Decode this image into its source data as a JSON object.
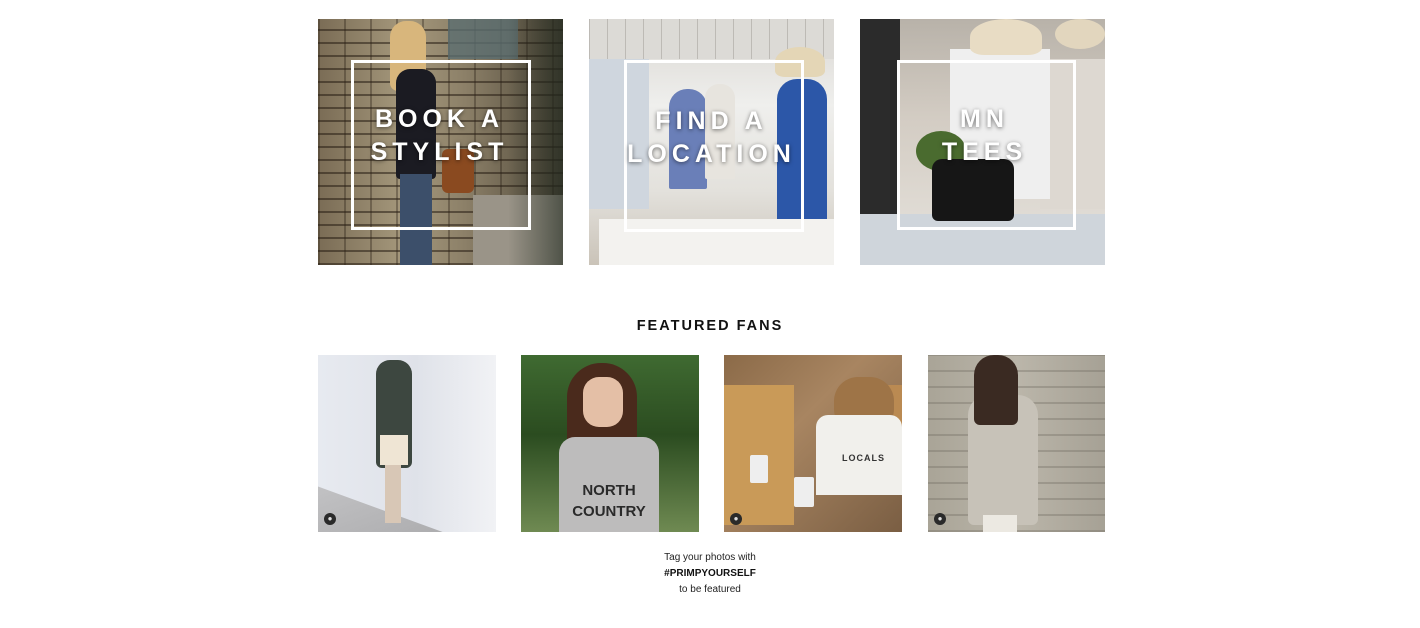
{
  "promos": [
    {
      "line1": "BOOK A",
      "line2": "STYLIST"
    },
    {
      "line1": "FIND A",
      "line2": "LOCATION"
    },
    {
      "line1": "MN",
      "line2": "TEES"
    }
  ],
  "featured": {
    "title": "FEATURED FANS",
    "fan_tees": {
      "fan2_line1": "NORTH",
      "fan2_line2": "COUNTRY",
      "fan3": "LOCALS"
    },
    "caption_line1": "Tag your photos with",
    "caption_hashtag": "#PRIMPYOURSELF",
    "caption_line3": "to be featured"
  },
  "icons": {
    "fan_badge": "user-icon"
  }
}
